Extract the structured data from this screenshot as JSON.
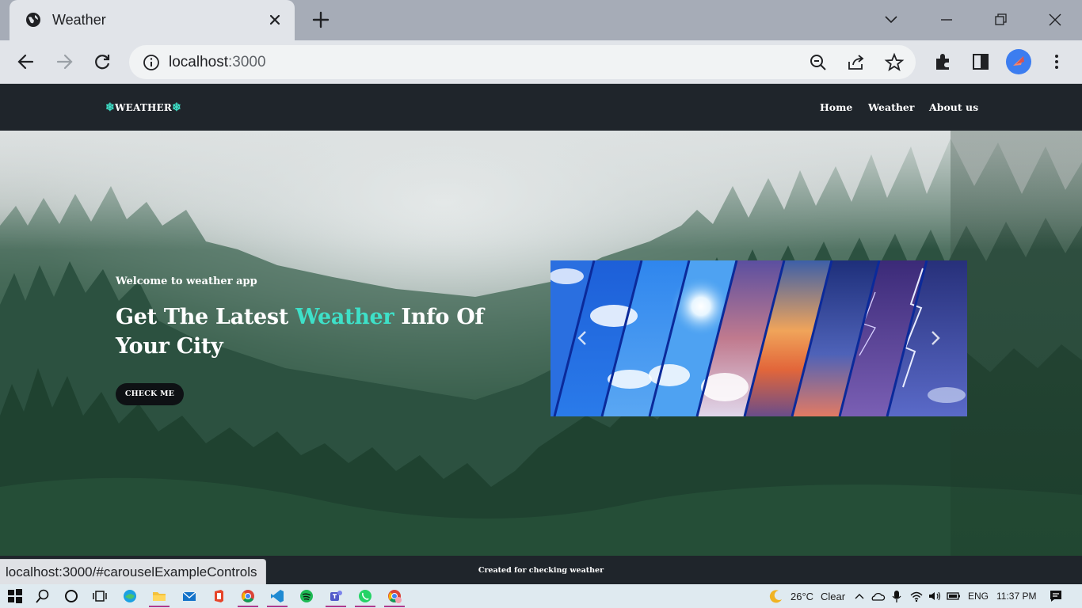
{
  "browser": {
    "tab_title": "Weather",
    "url_host": "localhost",
    "url_port": ":3000"
  },
  "navbar": {
    "brand": "WEATHER",
    "links": [
      "Home",
      "Weather",
      "About us"
    ]
  },
  "hero": {
    "welcome": "Welcome to weather app",
    "headline_before": "Get The Latest ",
    "headline_accent": "Weather",
    "headline_after": " Info Of Your City",
    "cta_label": "CHECK ME"
  },
  "footer": {
    "credit": "Created for checking weather"
  },
  "status": {
    "hover_url": "localhost:3000/#carouselExampleControls"
  },
  "taskbar": {
    "weather_temp": "26°C",
    "weather_cond": "Clear",
    "lang": "ENG",
    "time": "11:37 PM"
  },
  "colors": {
    "accent": "#3ee0c8",
    "navbar_bg": "#1f252b"
  }
}
